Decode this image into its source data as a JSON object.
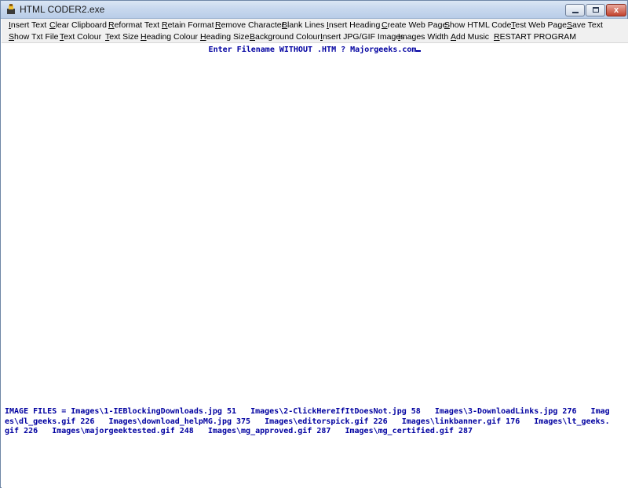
{
  "window": {
    "title": "HTML CODER2.exe"
  },
  "controls": {
    "minimize_icon": "minimize-icon",
    "maximize_icon": "maximize-icon",
    "close_glyph": "x"
  },
  "menu": {
    "row1": [
      "Insert Text",
      "Clear Clipboard",
      "Reformat Text",
      "Retain Format",
      "Remove Character",
      "Blank Lines",
      "Insert Heading",
      "Create Web Page",
      "Show HTML Code",
      "Test Web Page",
      "Save Text"
    ],
    "row2": [
      "Show Txt File",
      "Text Colour",
      "Text Size",
      "Heading Colour",
      "Heading Size",
      "Background Colour",
      "Insert JPG/GIF Images",
      "Images Width",
      "Add Music",
      "RESTART PROGRAM"
    ]
  },
  "console": {
    "prompt": "Enter Filename WITHOUT .HTM ? Majorgeeks.com",
    "image_files_lines": [
      "IMAGE FILES = Images\\1-IEBlockingDownloads.jpg 51   Images\\2-ClickHereIfItDoesNot.jpg 58   Images\\3-DownloadLinks.jpg 276   Imag",
      "es\\dl_geeks.gif 226   Images\\download_helpMG.jpg 375   Images\\editorspick.gif 226   Images\\linkbanner.gif 176   Images\\lt_geeks.",
      "gif 226   Images\\majorgeektested.gif 248   Images\\mg_approved.gif 287   Images\\mg_certified.gif 287"
    ]
  },
  "colors": {
    "console_text": "#0000a0",
    "menu_bg": "#f0f0f0",
    "title_bg": "#c8d8ee"
  }
}
